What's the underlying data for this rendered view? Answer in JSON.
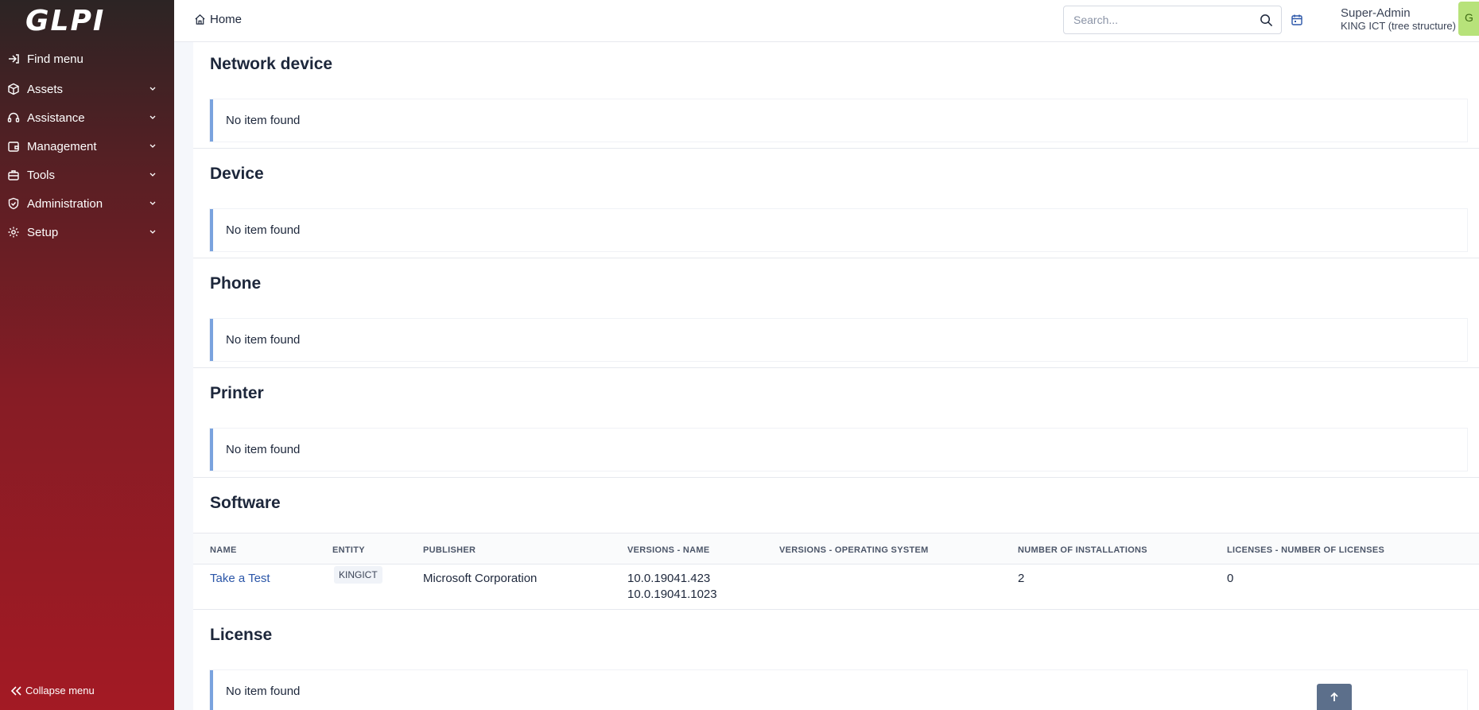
{
  "app": {
    "logo": "GLPI"
  },
  "sidebar": {
    "items": [
      {
        "label": "Find menu",
        "icon": "arrow-right-icon"
      },
      {
        "label": "Assets",
        "icon": "box-icon"
      },
      {
        "label": "Assistance",
        "icon": "headset-icon"
      },
      {
        "label": "Management",
        "icon": "wallet-icon"
      },
      {
        "label": "Tools",
        "icon": "briefcase-icon"
      },
      {
        "label": "Administration",
        "icon": "shield-icon"
      },
      {
        "label": "Setup",
        "icon": "gear-icon"
      }
    ],
    "collapse_label": "Collapse menu"
  },
  "topbar": {
    "breadcrumb": "Home",
    "search_placeholder": "Search...",
    "user_name": "Super-Admin",
    "user_entity": "KING ICT (tree structure)",
    "green_button_label": "G"
  },
  "sections": [
    {
      "title": "Network device",
      "message": "No item found"
    },
    {
      "title": "Device",
      "message": "No item found"
    },
    {
      "title": "Phone",
      "message": "No item found"
    },
    {
      "title": "Printer",
      "message": "No item found"
    },
    {
      "title": "Software"
    },
    {
      "title": "License",
      "message": "No item found"
    }
  ],
  "software_table": {
    "columns": [
      "NAME",
      "ENTITY",
      "PUBLISHER",
      "VERSIONS - NAME",
      "VERSIONS - OPERATING SYSTEM",
      "NUMBER OF INSTALLATIONS",
      "LICENSES - NUMBER OF LICENSES"
    ],
    "rows": [
      {
        "name": "Take a Test",
        "entity": "KINGICT",
        "publisher": "Microsoft Corporation",
        "version_1": "10.0.19041.423",
        "version_2": "10.0.19041.1023",
        "os": "",
        "installations": "2",
        "licenses": "0"
      }
    ]
  },
  "colors": {
    "accent": "#7aa3de",
    "link": "#2b56a8",
    "sidebar_top": "#2c2424",
    "sidebar_bottom": "#a31a24"
  }
}
